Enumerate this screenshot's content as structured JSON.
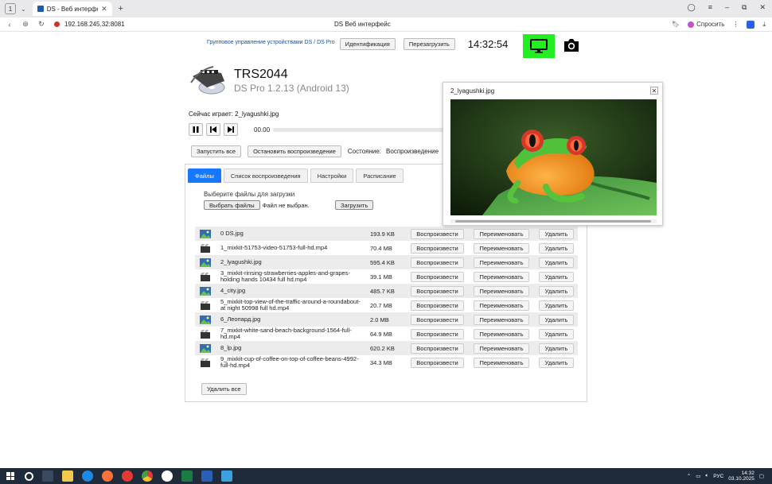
{
  "browser": {
    "tab_count": "1",
    "tab_title": "DS - Веб интерфейс",
    "url": "192.168.245.32:8081",
    "page_title": "DS  Веб интерфейс",
    "ask_label": "Спросить"
  },
  "header": {
    "group_link": "Групповое управление устройствами DS / DS Pro",
    "identify_label": "Идентификация",
    "reboot_label": "Перезагрузить",
    "clock": "14:32:54"
  },
  "device": {
    "name": "TRS2044",
    "version": "DS Pro 1.2.13 (Android 13)"
  },
  "player": {
    "now_playing": "Сейчас играет:  2_lyagushki.jpg",
    "time": "00.00",
    "progress": 0
  },
  "controls": {
    "start_all": "Запустить все",
    "stop_play": "Остановить воспроизведение",
    "state_label": "Состояние:",
    "state_value": "Воспроизведение"
  },
  "tabs": [
    {
      "label": "Файлы",
      "active": true
    },
    {
      "label": "Список воспроизведения",
      "active": false
    },
    {
      "label": "Настройки",
      "active": false
    },
    {
      "label": "Расписание",
      "active": false
    }
  ],
  "upload": {
    "title": "Выберите файлы для загрузки",
    "choose_label": "Выбрать файлы",
    "no_file": "Файл не выбран.",
    "upload_label": "Загрузить"
  },
  "file_buttons": {
    "play": "Воспроизвести",
    "rename": "Переименовать",
    "delete": "Удалить"
  },
  "files": [
    {
      "name": "0 DS.jpg",
      "size": "193.9 KB",
      "type": "image"
    },
    {
      "name": "1_mixkit-51753-video-51753-full-hd.mp4",
      "size": "70.4 MB",
      "type": "video"
    },
    {
      "name": "2_lyagushki.jpg",
      "size": "595.4 KB",
      "type": "image"
    },
    {
      "name": "3_mixkit-rinsing-strawberries-apples-and-grapes-holding hands 10434 full hd.mp4",
      "size": "39.1 MB",
      "type": "video"
    },
    {
      "name": "4_city.jpg",
      "size": "485.7 KB",
      "type": "image"
    },
    {
      "name": "5_mixkit-top-view-of-the-traffic-around-a-roundabout-at night 50998 full hd.mp4",
      "size": "20.7 MB",
      "type": "video"
    },
    {
      "name": "6_Леопард.jpg",
      "size": "2.0 MB",
      "type": "image"
    },
    {
      "name": "7_mixkit-white-sand-beach-background-1564-full-hd.mp4",
      "size": "64.9 MB",
      "type": "video"
    },
    {
      "name": "8_lp.jpg",
      "size": "620.2 KB",
      "type": "image"
    },
    {
      "name": "9_mixkit-cup-of-coffee-on-top-of-coffee-beans-4992-full-hd.mp4",
      "size": "34.3 MB",
      "type": "video"
    }
  ],
  "delete_all": "Удалить все",
  "preview": {
    "title": "2_lyagushki.jpg"
  },
  "tray": {
    "lang": "РУС",
    "time": "14:32",
    "date": "03.10.2025"
  }
}
